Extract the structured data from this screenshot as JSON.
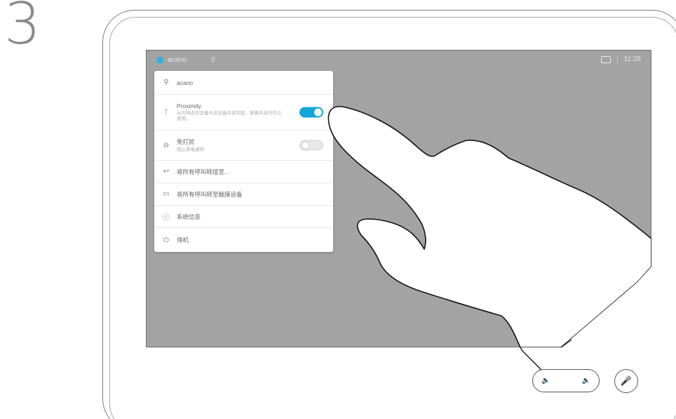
{
  "step": {
    "number": "3"
  },
  "topbar": {
    "system_name": "acano",
    "proximity_icon": "proximity-icon",
    "camera_icon": "camera-icon",
    "separator": "|",
    "time": "11:28"
  },
  "menu": {
    "items": [
      {
        "icon": "location-pin-icon",
        "label": "acano",
        "sub": ""
      },
      {
        "icon": "proximity-icon",
        "label": "Proximity",
        "sub": "允许附近的设备与此设备共享内容，屏幕共享时可以使用。",
        "toggle": "on"
      },
      {
        "icon": "do-not-disturb-icon",
        "label": "免打扰",
        "sub": "阻止来电通知",
        "toggle": "off"
      },
      {
        "icon": "forward-call-icon",
        "label": "将所有呼叫转接至...",
        "sub": ""
      },
      {
        "icon": "touch-device-icon",
        "label": "将所有呼叫转至触摸设备",
        "sub": ""
      },
      {
        "icon": "info-icon",
        "label": "系统信息",
        "sub": ""
      },
      {
        "icon": "power-icon",
        "label": "待机",
        "sub": ""
      }
    ]
  },
  "controls": {
    "volume_down_icon": "volume-down-icon",
    "volume_up_icon": "volume-up-icon",
    "mute_icon": "microphone-mute-icon"
  },
  "colors": {
    "screen": "#a3a3a3",
    "accent": "#13a7d8",
    "status_dot": "#2fb3d6"
  }
}
